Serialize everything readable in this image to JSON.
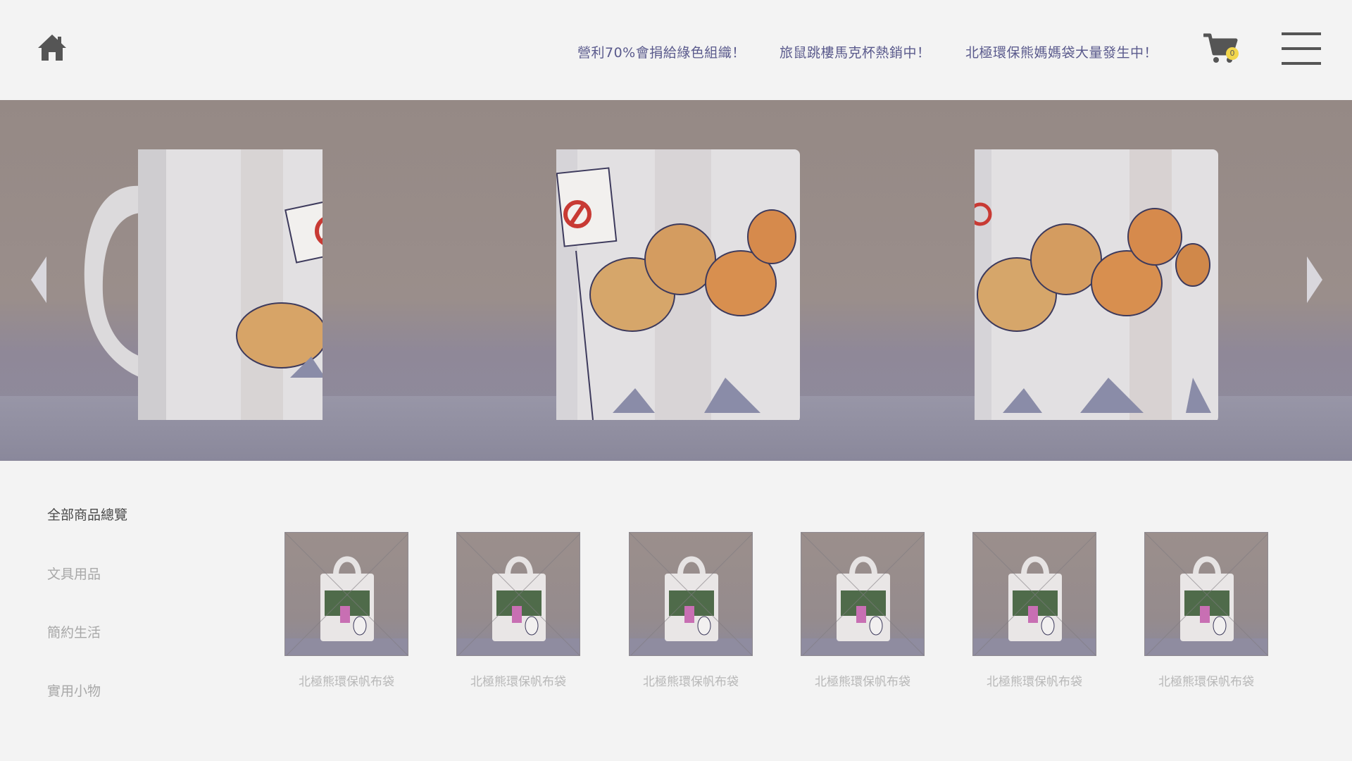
{
  "header": {
    "home_icon": "home-icon",
    "nav": [
      "營利70%會捐給綠色組織！",
      "旅鼠跳樓馬克杯熱銷中！",
      "北極環保熊媽媽袋大量發生中！"
    ],
    "cart_icon": "shopping-cart-icon",
    "cart_count": "0",
    "menu_icon": "hamburger-menu-icon"
  },
  "carousel": {
    "prev_icon": "chevron-left-icon",
    "next_icon": "chevron-right-icon"
  },
  "sidebar": {
    "items": [
      "全部商品總覽",
      "文具用品",
      "簡約生活",
      "實用小物"
    ],
    "active_index": 0
  },
  "products": [
    {
      "name": "北極熊環保帆布袋"
    },
    {
      "name": "北極熊環保帆布袋"
    },
    {
      "name": "北極熊環保帆布袋"
    },
    {
      "name": "北極熊環保帆布袋"
    },
    {
      "name": "北極熊環保帆布袋"
    },
    {
      "name": "北極熊環保帆布袋"
    }
  ],
  "colors": {
    "nav_text": "#5a5a8c",
    "badge": "#f2d64b",
    "sidebar_active": "#4a4a4a",
    "sidebar_inactive": "#a8a8a8"
  }
}
